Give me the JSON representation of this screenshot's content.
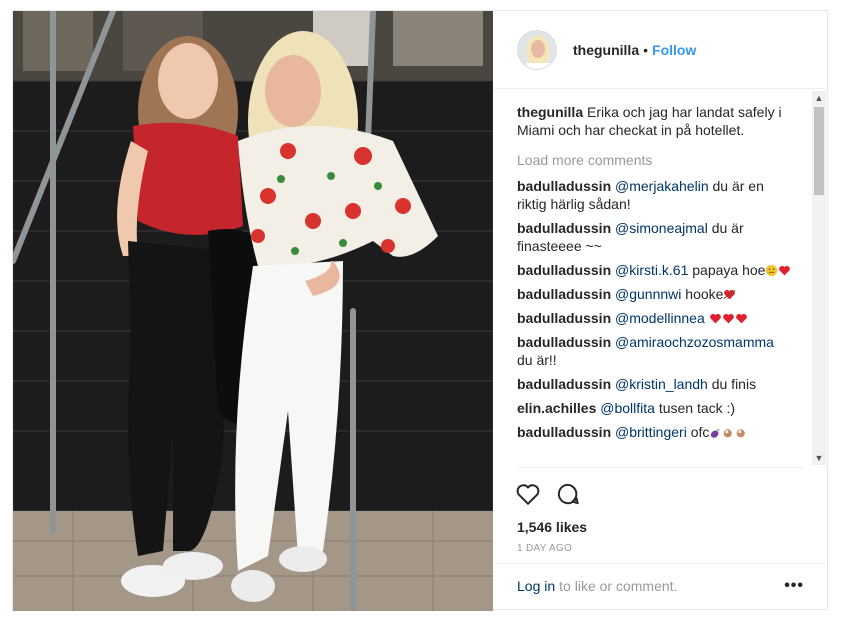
{
  "post": {
    "username": "thegunilla",
    "separator": "•",
    "follow_label": "Follow",
    "caption": {
      "username": "thegunilla",
      "text": "Erika och jag har landat safely i Miami och har checkat in på hotellet."
    },
    "load_more_label": "Load more comments",
    "comments": [
      {
        "user": "badulladussin",
        "mention": "@merjakahelin",
        "text": " du är en riktig härlig sådan!",
        "emoji": []
      },
      {
        "user": "badulladussin",
        "mention": "@simoneajmal",
        "text": " du är finasteeee ~~",
        "emoji": []
      },
      {
        "user": "badulladussin",
        "mention": "@kirsti.k.61",
        "text": " papaya hoe",
        "emoji": [
          "disappointed-face-emoji",
          "red-heart-emoji"
        ]
      },
      {
        "user": "badulladussin",
        "mention": "@gunnnwi",
        "text": " hooke",
        "emoji": [
          "heart-with-arrow-emoji"
        ]
      },
      {
        "user": "badulladussin",
        "mention": "@modellinnea",
        "text": " ",
        "emoji": [
          "red-heart-emoji",
          "red-heart-emoji",
          "red-heart-emoji"
        ]
      },
      {
        "user": "badulladussin",
        "mention": "@amiraochzozosmamma",
        "text": " du är!!",
        "emoji": []
      },
      {
        "user": "badulladussin",
        "mention": "@kristin_landh",
        "text": " du finis",
        "emoji": []
      },
      {
        "user": "elin.achilles",
        "mention": "@bollfita",
        "text": " tusen tack :)",
        "emoji": []
      },
      {
        "user": "badulladussin",
        "mention": "@brittingeri",
        "text": " ofc",
        "emoji": [
          "eggplant-emoji",
          "ok-hand-emoji",
          "ok-hand-emoji"
        ]
      }
    ],
    "likes_label": "1,546 likes",
    "time_label": "1 DAY AGO",
    "login_link": "Log in",
    "login_text": "to like or comment.",
    "more_label": "•••",
    "icons": [
      "heart-icon",
      "comment-icon",
      "more-options-icon"
    ],
    "colors": {
      "link": "#3897f0",
      "mention": "#003569",
      "muted": "#999999"
    }
  }
}
